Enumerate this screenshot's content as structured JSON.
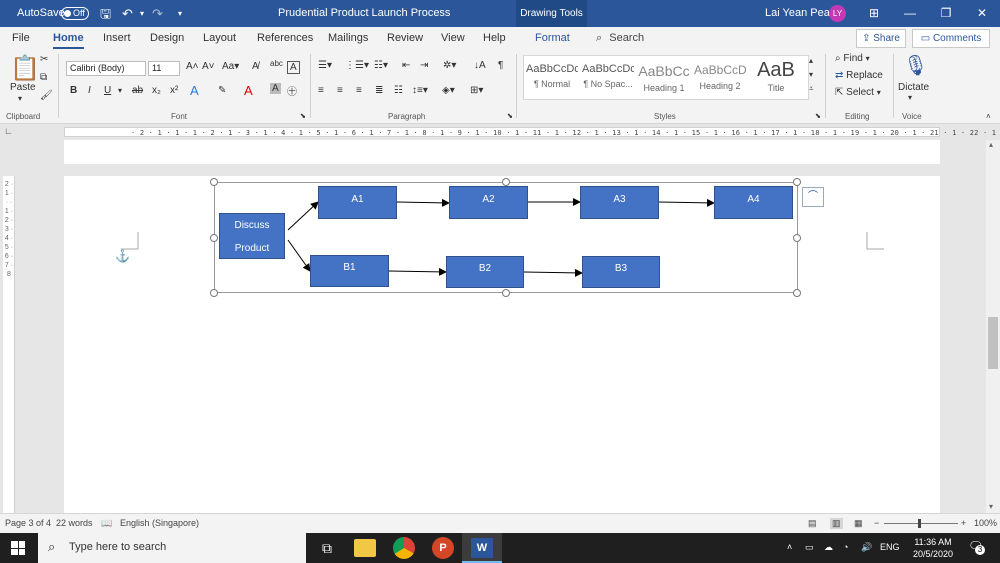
{
  "titlebar": {
    "autosave_label": "AutoSave",
    "autosave_state": "Off",
    "doc_title": "Prudential Product Launch Process",
    "context_tab": "Drawing Tools",
    "user_name": "Lai Yean Pean",
    "user_initials": "LY"
  },
  "menu": {
    "tabs": [
      "File",
      "Home",
      "Insert",
      "Design",
      "Layout",
      "References",
      "Mailings",
      "Review",
      "View",
      "Help",
      "Format"
    ],
    "search": "Search",
    "share": "Share",
    "comments": "Comments"
  },
  "ribbon": {
    "clipboard": {
      "paste": "Paste",
      "label": "Clipboard"
    },
    "font": {
      "name": "Calibri (Body)",
      "size": "11",
      "label": "Font"
    },
    "paragraph": {
      "label": "Paragraph"
    },
    "styles": {
      "label": "Styles",
      "items": [
        {
          "sample": "AaBbCcDc",
          "name": "¶ Normal"
        },
        {
          "sample": "AaBbCcDc",
          "name": "¶ No Spac..."
        },
        {
          "sample": "AaBbCc",
          "name": "Heading 1"
        },
        {
          "sample": "AaBbCcD",
          "name": "Heading 2"
        },
        {
          "sample": "AaB",
          "name": "Title"
        }
      ]
    },
    "editing": {
      "find": "Find",
      "replace": "Replace",
      "select": "Select",
      "label": "Editing"
    },
    "voice": {
      "dictate": "Dictate",
      "label": "Voice"
    }
  },
  "ruler": {
    "text": "· 2 · 1 · 1 · 1 · 2 · 1 · 3 · 1 · 4 · 1 · 5 · 1 · 6 · 1 · 7 · 1 · 8 · 1 · 9 · 1 · 10 · 1 · 11 · 1 · 12 · 1 · 13 · 1 · 14 · 1 · 15 · 1 · 16 · 1 · 17 · 1 · 18 · 1 · 19 · 1 · 20 · 1 · 21 · 1 · 22 · 1 · 23 · 1 · 24 · 1 · 25 · 1 · 26 · 1 · 27",
    "vtext": "2 · 1 · · · 1 · 2 · 3 · 4 · 5 · 6 · 7 · 8"
  },
  "diagram": {
    "start": {
      "line1": "Discuss",
      "line2": "Product"
    },
    "row_a": [
      "A1",
      "A2",
      "A3",
      "A4"
    ],
    "row_b": [
      "B1",
      "B2",
      "B3"
    ]
  },
  "status": {
    "page": "Page 3 of 4",
    "words": "22 words",
    "language": "English (Singapore)",
    "zoom": "100%"
  },
  "taskbar": {
    "search_placeholder": "Type here to search",
    "lang": "ENG",
    "time": "11:36 AM",
    "date": "20/5/2020",
    "notifications": "3"
  },
  "colors": {
    "word_blue": "#2b579a",
    "shape_fill": "#4472c4",
    "avatar": "#c239b3"
  }
}
